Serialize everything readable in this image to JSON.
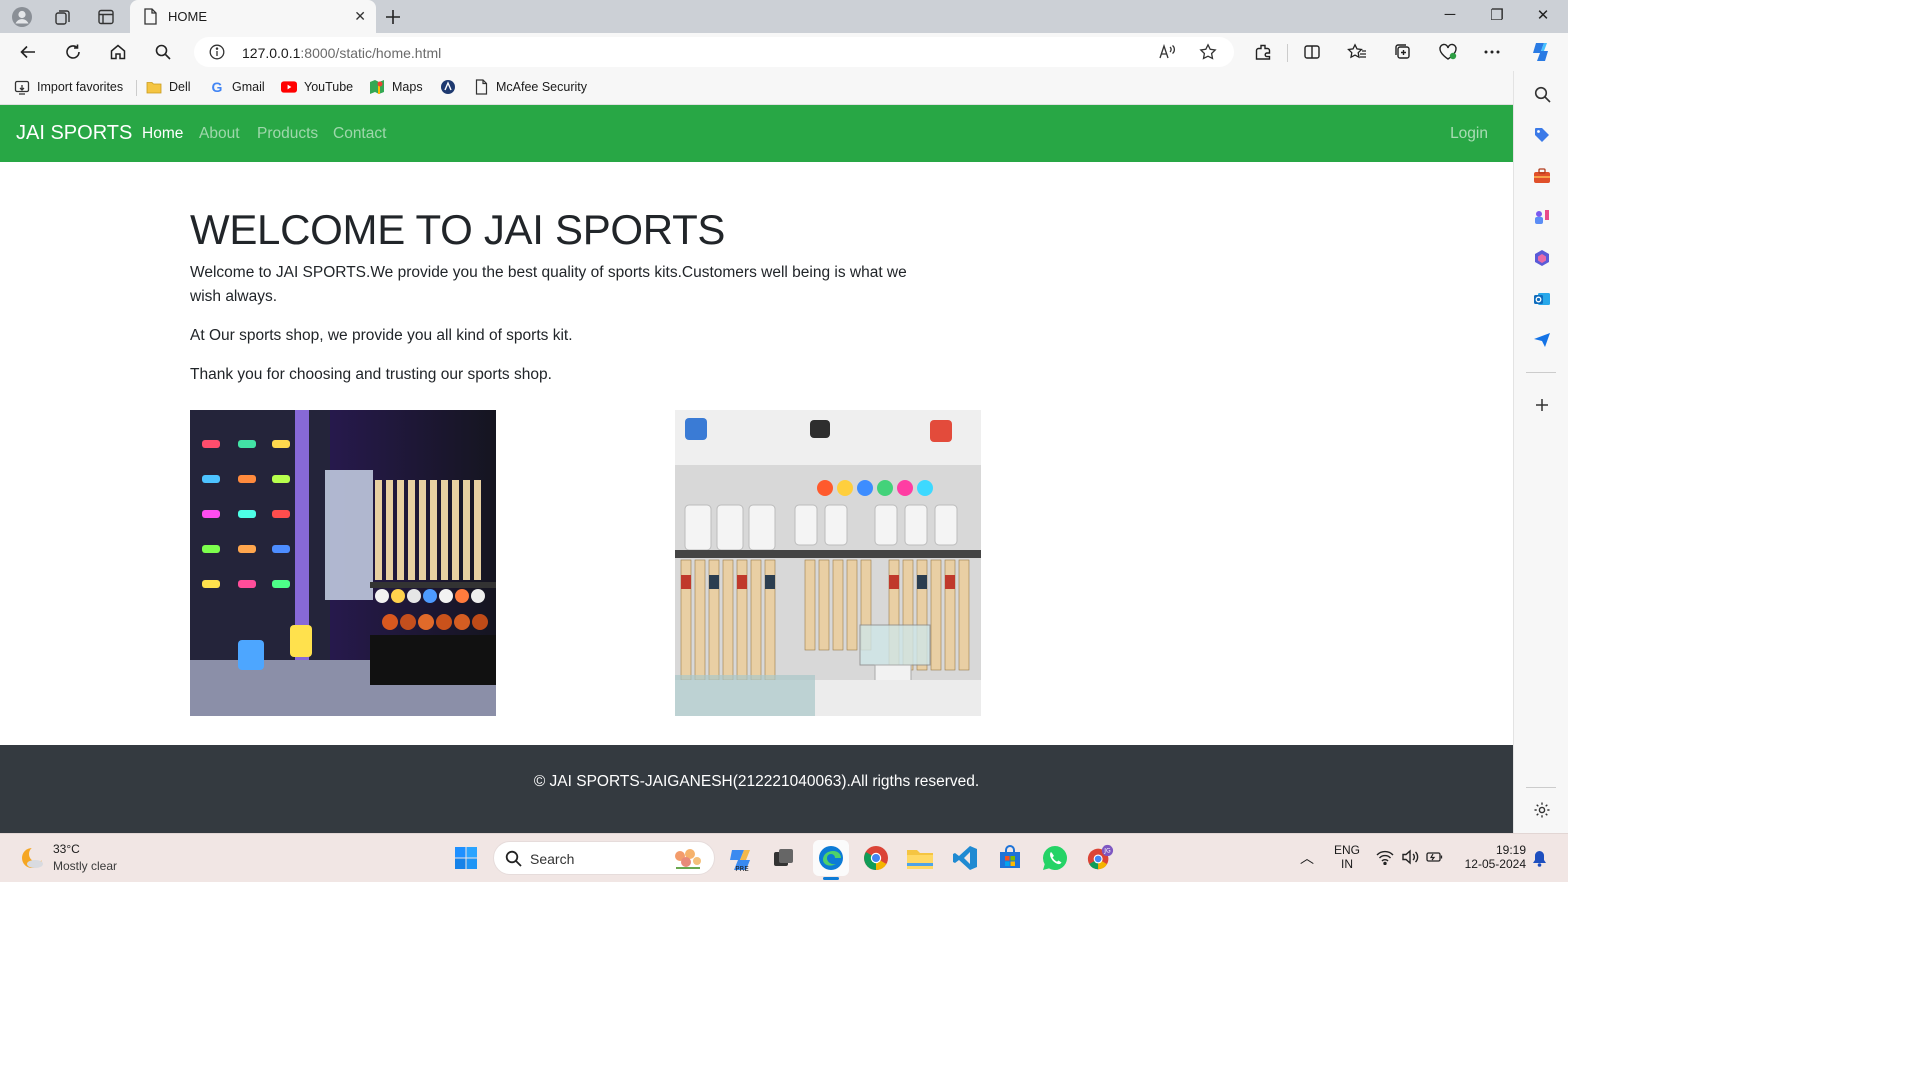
{
  "browser": {
    "tab_title": "HOME",
    "url_host": "127.0.0.1",
    "url_path": ":8000/static/home.html",
    "favorites": [
      "Import favorites",
      "Dell",
      "Gmail",
      "YouTube",
      "Maps",
      "McAfee Security"
    ]
  },
  "site": {
    "brand": "JAI SPORTS",
    "nav": [
      "Home",
      "About",
      "Products",
      "Contact"
    ],
    "login": "Login",
    "heading": "WELCOME TO JAI SPORTS",
    "paragraphs": [
      "Welcome to JAI SPORTS.We provide you the best quality of sports kits.Customers well being is what we wish always.",
      "At Our sports shop, we provide you all kind of sports kit.",
      "Thank you for choosing and trusting our sports shop."
    ],
    "footer": "© JAI SPORTS-JAIGANESH(212221040063).All rigths reserved.",
    "colors": {
      "navbar": "#28a745",
      "footer": "#343a40"
    }
  },
  "taskbar": {
    "temperature": "33°C",
    "weather": "Mostly clear",
    "search_label": "Search",
    "lang_top": "ENG",
    "lang_bottom": "IN",
    "time": "19:19",
    "date": "12-05-2024"
  }
}
